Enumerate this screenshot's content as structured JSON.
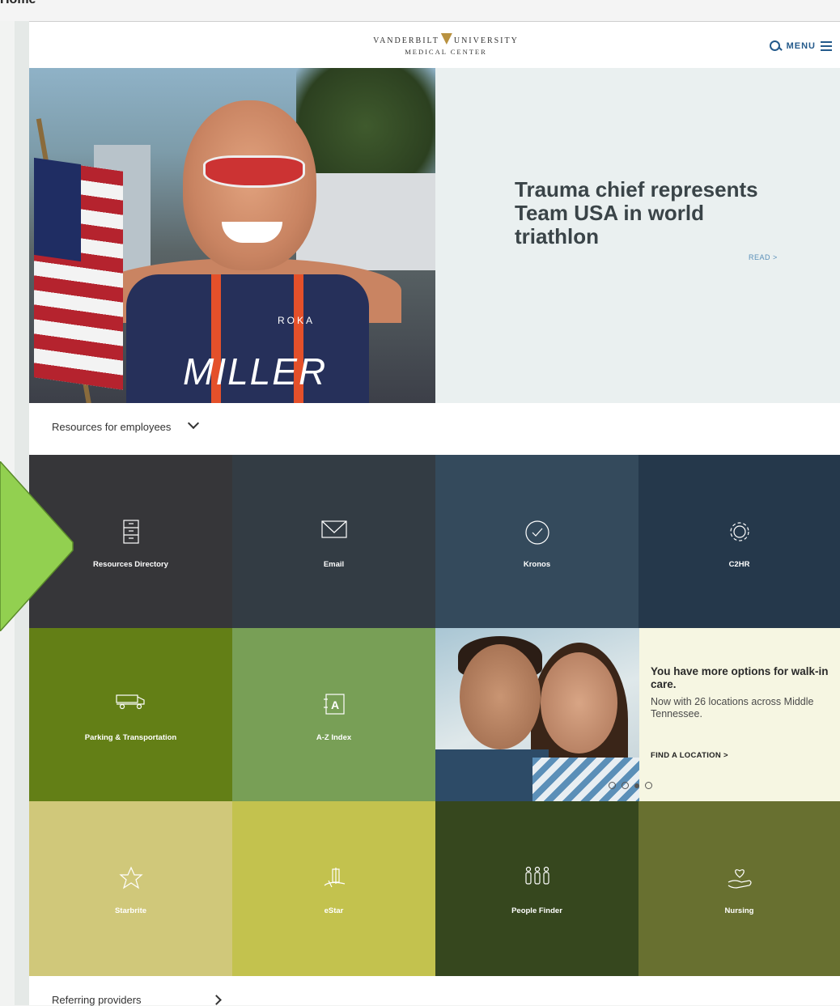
{
  "browser_strip": {
    "cut_text": "Home"
  },
  "header": {
    "logo_line1": "VANDERBILT",
    "logo_line1b": "UNIVERSITY",
    "logo_line2": "MEDICAL CENTER",
    "menu_label": "MENU"
  },
  "hero": {
    "jersey_text": "MILLER",
    "jersey_brand": "ROKA",
    "title": "Trauma chief represents Team USA in world triathlon",
    "read_label": "READ >"
  },
  "resources": {
    "label": "Resources for employees"
  },
  "tiles": [
    {
      "label": "Resources Directory",
      "icon": "cabinet-icon",
      "color": "#363639"
    },
    {
      "label": "Email",
      "icon": "envelope-icon",
      "color": "#333c44"
    },
    {
      "label": "Kronos",
      "icon": "clock-check-icon",
      "color": "#344a5c"
    },
    {
      "label": "C2HR",
      "icon": "gear-icon",
      "color": "#25384b"
    },
    {
      "label": "Parking & Transportation",
      "icon": "shuttle-icon",
      "color": "#637f16"
    },
    {
      "label": "A-Z Index",
      "icon": "az-index-icon",
      "color": "#789f56"
    },
    {
      "label": "Starbrite",
      "icon": "star-icon",
      "color": "#d0c87a"
    },
    {
      "label": "eStar",
      "icon": "estar-icon",
      "color": "#c3c24e"
    },
    {
      "label": "People Finder",
      "icon": "people-icon",
      "color": "#36471e"
    },
    {
      "label": "Nursing",
      "icon": "heart-hand-icon",
      "color": "#687030"
    }
  ],
  "promo": {
    "title": "You have more options for walk-in care.",
    "subtitle": "Now with 26 locations across Middle Tennessee.",
    "cta": "FIND A LOCATION >",
    "slides": 4,
    "active_slide": 3
  },
  "referring": {
    "label": "Referring providers"
  },
  "colors": {
    "accent": "#245a8b",
    "arrow": "#92d050",
    "read": "#5a8fb9"
  }
}
